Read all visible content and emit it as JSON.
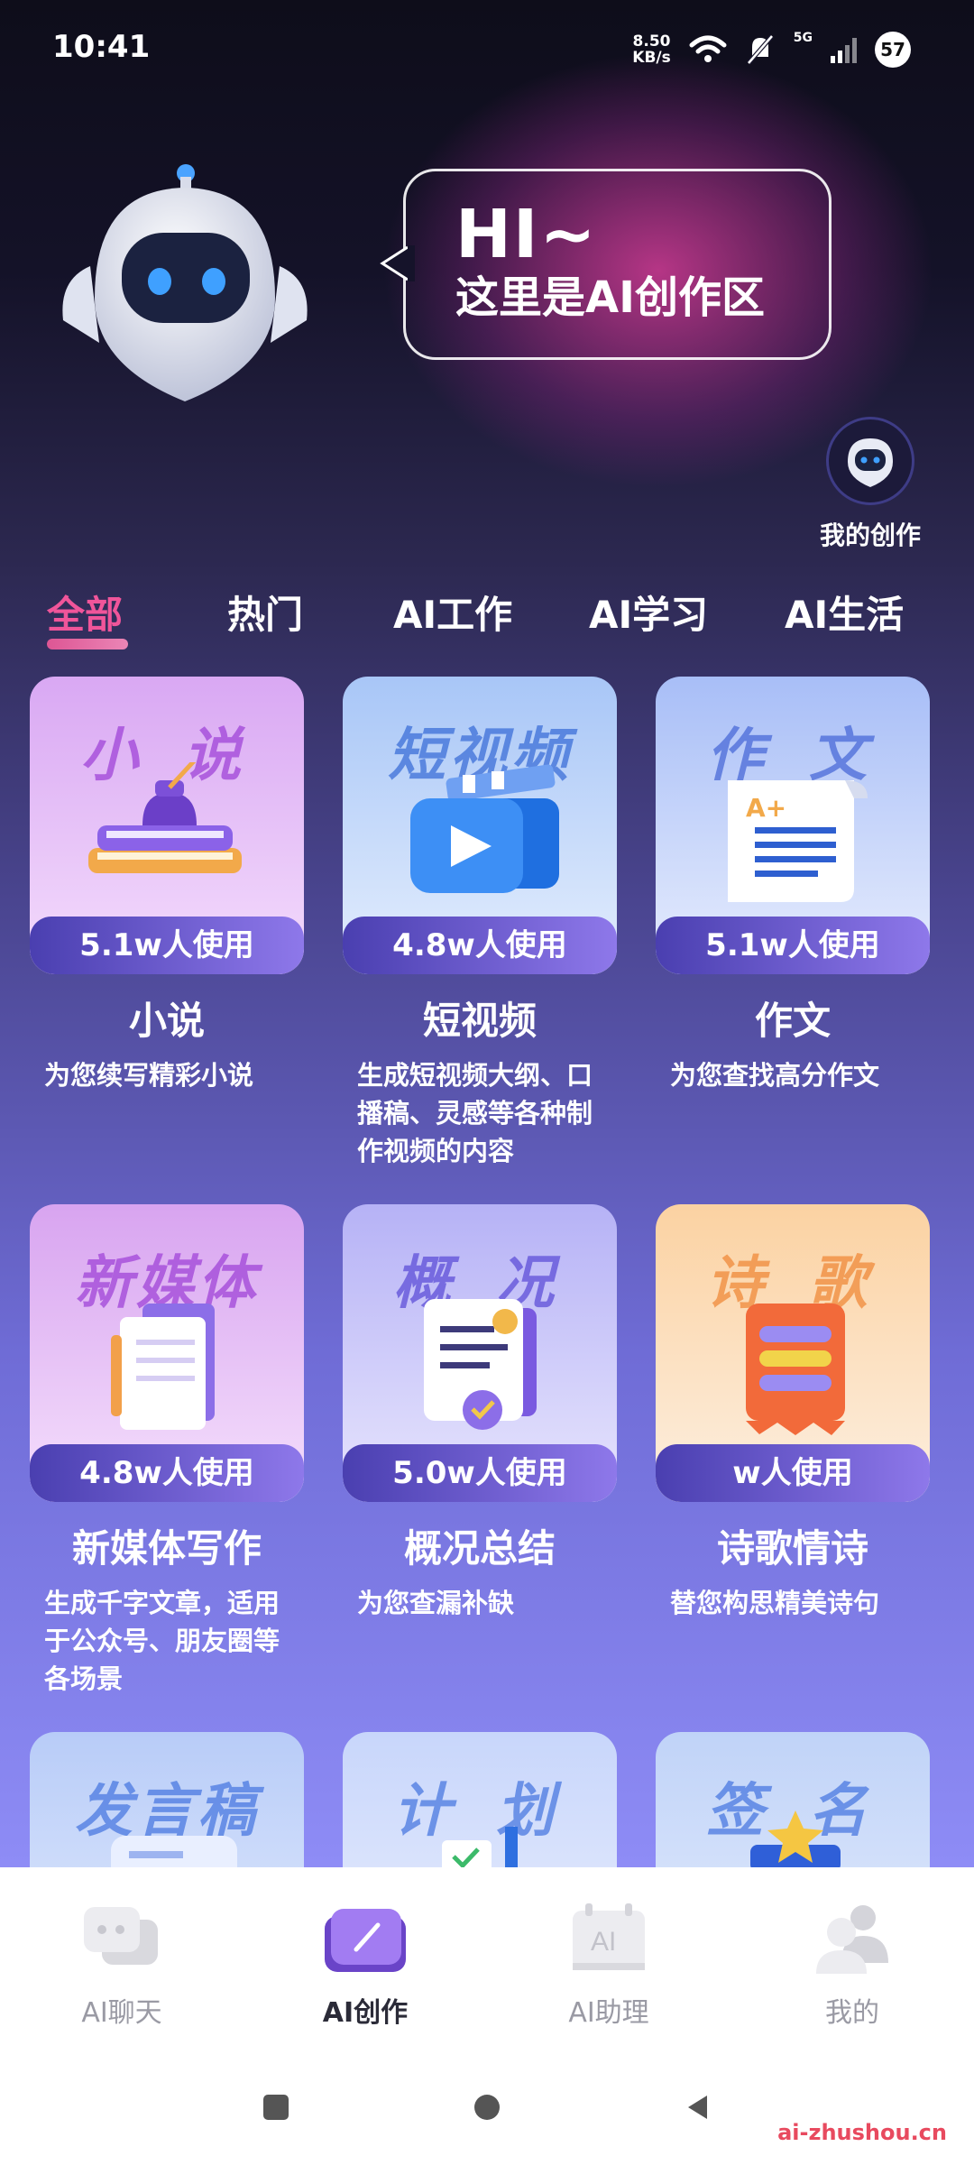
{
  "status_bar": {
    "time": "10:41",
    "net_speed_value": "8.50",
    "net_speed_unit": "KB/s",
    "network_type": "5G",
    "battery": "57"
  },
  "hero": {
    "greeting": "HI~",
    "subtitle": "这里是AI创作区",
    "my_creation_label": "我的创作"
  },
  "tabs": [
    {
      "label": "全部",
      "active": true
    },
    {
      "label": "热门",
      "active": false
    },
    {
      "label": "AI工作",
      "active": false
    },
    {
      "label": "AI学习",
      "active": false
    },
    {
      "label": "AI生活",
      "active": false
    }
  ],
  "cards": [
    {
      "art_title": "小 说",
      "usage": "5.1w人使用",
      "name": "小说",
      "desc": "为您续写精彩小说",
      "color_top": "#d8a6f2",
      "color_bottom": "#f2d8fb"
    },
    {
      "art_title": "短视频",
      "usage": "4.8w人使用",
      "name": "短视频",
      "desc": "生成短视频大纲、口播稿、灵感等各种制作视频的内容",
      "color_top": "#a9c8f7",
      "color_bottom": "#e3eefc"
    },
    {
      "art_title": "作 文",
      "usage": "5.1w人使用",
      "name": "作文",
      "desc": "为您查找高分作文",
      "color_top": "#a9bff7",
      "color_bottom": "#e6ecfd"
    },
    {
      "art_title": "新媒体",
      "usage": "4.8w人使用",
      "name": "新媒体写作",
      "desc": "生成千字文章，适用于公众号、朋友圈等各场景",
      "color_top": "#d9a5f0",
      "color_bottom": "#f4defb"
    },
    {
      "art_title": "概 况",
      "usage": "5.0w人使用",
      "name": "概况总结",
      "desc": "为您查漏补缺",
      "color_top": "#b7b3f6",
      "color_bottom": "#e6e4fd"
    },
    {
      "art_title": "诗 歌",
      "usage": "w人使用",
      "name": "诗歌情诗",
      "desc": "替您构思精美诗句",
      "color_top": "#fbd3a4",
      "color_bottom": "#fdeede"
    },
    {
      "art_title": "发言稿",
      "color_top": "#b8cdf8",
      "color_bottom": "#e6eefd"
    },
    {
      "art_title": "计 划",
      "color_top": "#c9d6fb",
      "color_bottom": "#eef2fe"
    },
    {
      "art_title": "签 名",
      "color_top": "#c0d3f8",
      "color_bottom": "#e8effd"
    }
  ],
  "bottom_nav": [
    {
      "label": "AI聊天",
      "active": false
    },
    {
      "label": "AI创作",
      "active": true
    },
    {
      "label": "AI助理",
      "active": false
    },
    {
      "label": "我的",
      "active": false
    }
  ],
  "watermark": "ai-zhushou.cn"
}
